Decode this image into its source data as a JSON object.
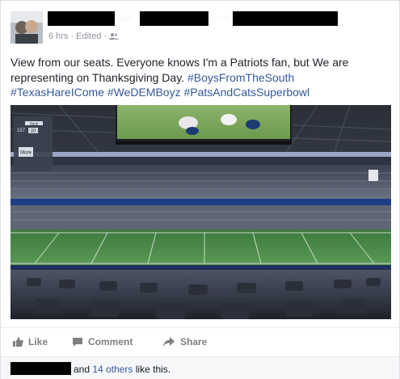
{
  "header": {
    "with_word": "with",
    "and_word": "and",
    "time": "6 hrs",
    "sep1": "·",
    "edited": "Edited",
    "sep2": "·",
    "privacy_icon": "friends-icon"
  },
  "post": {
    "text": "View from our seats. Everyone knows I'm a Patriots fan, but We are representing on Thanksgiving Day.",
    "hashtags": [
      "#BoysFromTheSouth",
      "#TexasHareICome",
      "#WeDEMBoyz",
      "#PatsAndCatsSuperbowl"
    ]
  },
  "photo": {
    "scoreboard_labels": [
      "Back",
      "More"
    ],
    "scoreboard_numbers": [
      "157",
      "20"
    ]
  },
  "actions": {
    "like": "Like",
    "comment": "Comment",
    "share": "Share"
  },
  "likes": {
    "and": "and",
    "others": "14 others",
    "suffix": "like this."
  },
  "colors": {
    "link": "#365899",
    "muted": "#90949c",
    "action": "#7f7f7f"
  }
}
